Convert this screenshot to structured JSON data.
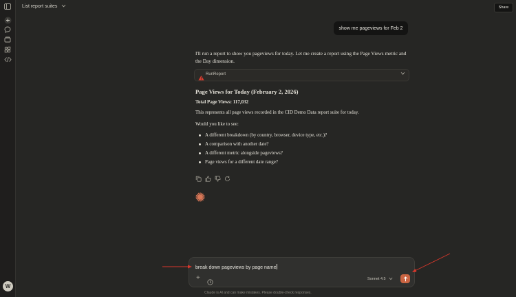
{
  "topbar": {
    "title": "List report suites",
    "share_label": "Share"
  },
  "sidebar": {
    "icons": [
      "sidebar-toggle-icon",
      "new-chat-icon",
      "chats-icon",
      "projects-icon",
      "artifacts-icon",
      "code-icon"
    ],
    "avatar_initial": "W"
  },
  "chat": {
    "user_message": "show me pageviews for Feb 2",
    "intro": "I'll run a report to show you pageviews for today. Let me create a report using the Page Views metric and the Day dimension.",
    "tool": {
      "name": "RunReport"
    },
    "heading": "Page Views for Today (February 2, 2026)",
    "total": "Total Page Views: 117,032",
    "paragraph": "This represents all page views recorded in the CID Demo Data report suite for today.",
    "question": "Would you like to see:",
    "options": [
      "A different breakdown (by country, browser, device type, etc.)?",
      "A comparison with another date?",
      "A different metric alongside pageviews?",
      "Page views for a different date range?"
    ]
  },
  "composer": {
    "text": "break down pageviews by page name",
    "model": "Sonnet 4.5"
  },
  "colors": {
    "accent": "#c96442",
    "annotation_arrow": "#d8372b",
    "tool_warning": "#d63c2f"
  },
  "disclaimer": "Claude is AI and can make mistakes. Please double-check responses."
}
